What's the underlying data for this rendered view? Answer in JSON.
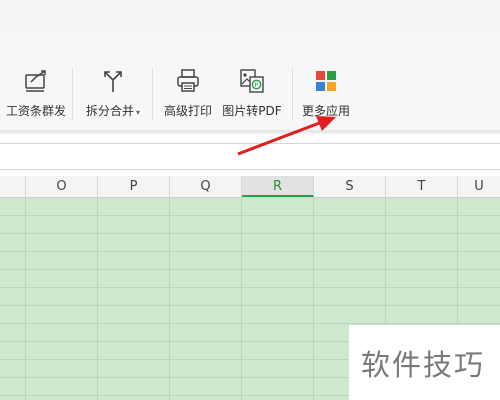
{
  "toolbar": {
    "tools": [
      {
        "label": "工资条群发",
        "icon": "payslip-send-icon"
      },
      {
        "label": "拆分合并",
        "icon": "split-merge-icon",
        "caret": "▾"
      },
      {
        "label": "高级打印",
        "icon": "printer-icon"
      },
      {
        "label": "图片转PDF",
        "icon": "image-to-pdf-icon"
      },
      {
        "label": "更多应用",
        "icon": "more-apps-icon"
      }
    ]
  },
  "sheet": {
    "columns": [
      "O",
      "P",
      "Q",
      "R",
      "S",
      "T",
      "U"
    ],
    "selected_column": "R"
  },
  "colors": {
    "grid_fill": "#cce8cf",
    "selected_accent": "#2e9d47",
    "arrow": "#e02020"
  },
  "watermark": {
    "text": "软件技巧"
  }
}
